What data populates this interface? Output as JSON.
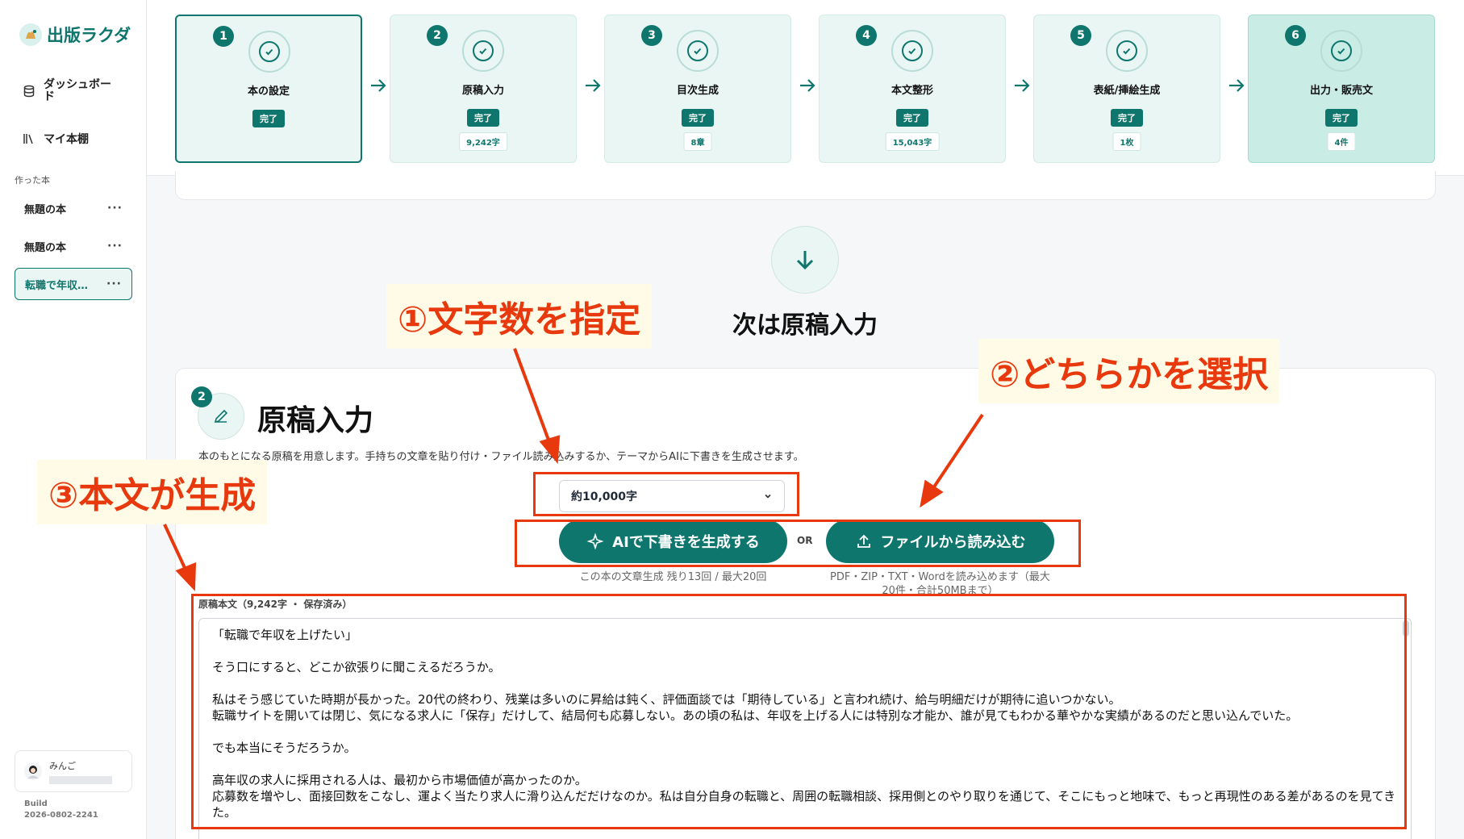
{
  "app": {
    "logo_text": "出版ラクダ"
  },
  "sidebar": {
    "nav": [
      {
        "label": "ダッシュボード"
      },
      {
        "label": "マイ本棚"
      }
    ],
    "section_title": "作った本",
    "books": [
      {
        "title": "無題の本",
        "menu": "···"
      },
      {
        "title": "無題の本",
        "menu": "···"
      },
      {
        "title": "転職で年収…",
        "menu": "···"
      }
    ],
    "user": {
      "name": "みんご"
    },
    "build": {
      "label": "Build",
      "value": "2026-0802-2241"
    }
  },
  "steps": [
    {
      "num": "1",
      "label": "本の設定",
      "status": "完了",
      "count": ""
    },
    {
      "num": "2",
      "label": "原稿入力",
      "status": "完了",
      "count": "9,242字"
    },
    {
      "num": "3",
      "label": "目次生成",
      "status": "完了",
      "count": "8章"
    },
    {
      "num": "4",
      "label": "本文整形",
      "status": "完了",
      "count": "15,043字"
    },
    {
      "num": "5",
      "label": "表紙/挿絵生成",
      "status": "完了",
      "count": "1枚"
    },
    {
      "num": "6",
      "label": "出力・販売文",
      "status": "完了",
      "count": "4件"
    }
  ],
  "next": {
    "title": "次は原稿入力"
  },
  "section": {
    "num": "2",
    "title": "原稿入力",
    "description": "本のもとになる原稿を用意します。手持ちの文章を貼り付け・ファイル読み込みするか、テーマからAIに下書きを生成させます。",
    "length_select": "約10,000字",
    "ai_button": "AIで下書きを生成する",
    "or": "OR",
    "file_button": "ファイルから読み込む",
    "ai_hint": "この本の文章生成 残り13回 / 最大20回",
    "file_hint": "PDF・ZIP・TXT・Wordを読み込めます（最大20件・合計50MBまで）",
    "textarea_label": "原稿本文（9,242字 ・ 保存済み）",
    "textarea_value": "「転職で年収を上げたい」\n\nそう口にすると、どこか欲張りに聞こえるだろうか。\n\n私はそう感じていた時期が長かった。20代の終わり、残業は多いのに昇給は鈍く、評価面談では「期待している」と言われ続け、給与明細だけが期待に追いつかない。\n転職サイトを開いては閉じ、気になる求人に「保存」だけして、結局何も応募しない。あの頃の私は、年収を上げる人には特別な才能か、誰が見てもわかる華やかな実績があるのだと思い込んでいた。\n\nでも本当にそうだろうか。\n\n高年収の求人に採用される人は、最初から市場価値が高かったのか。\n応募数を増やし、面接回数をこなし、運よく当たり求人に滑り込んだだけなのか。私は自分自身の転職と、周囲の転職相談、採用側とのやり取りを通じて、そこにもっと地味で、もっと再現性のある差があるのを見てきた。"
  },
  "callouts": {
    "c1": "①文字数を指定",
    "c2": "②どちらかを選択",
    "c3": "③本文が生成"
  },
  "colors": {
    "accent": "#0f766e",
    "annotation": "#e8390e"
  }
}
